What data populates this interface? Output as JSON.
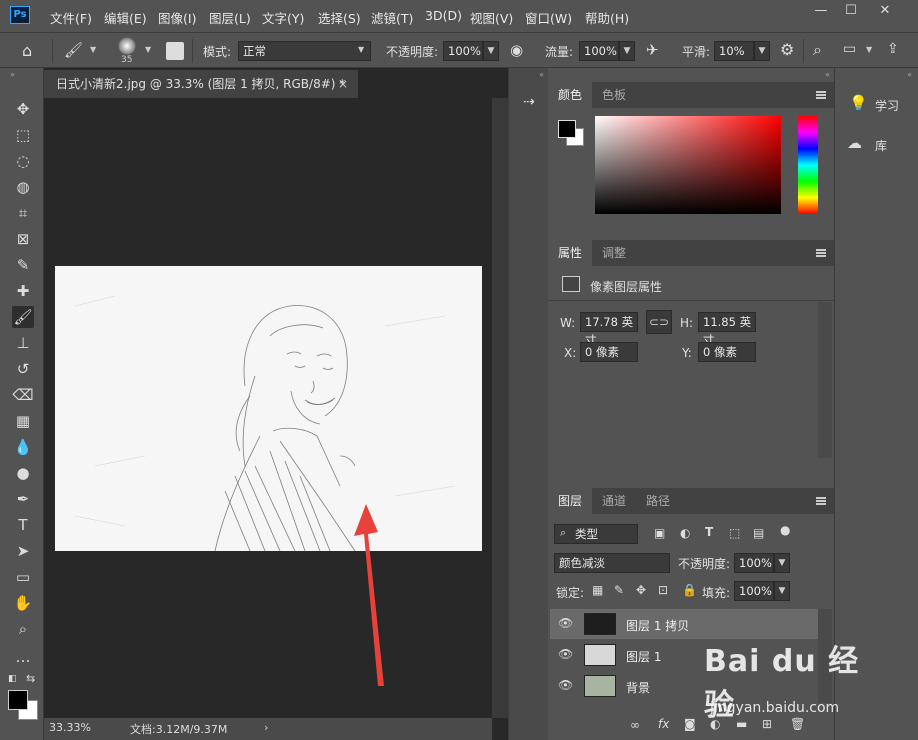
{
  "app": {
    "logo": "Ps"
  },
  "menu": [
    "文件(F)",
    "编辑(E)",
    "图像(I)",
    "图层(L)",
    "文字(Y)",
    "选择(S)",
    "滤镜(T)",
    "3D(D)",
    "视图(V)",
    "窗口(W)",
    "帮助(H)"
  ],
  "window_controls": {
    "minimize": "—",
    "maximize": "☐",
    "close": "✕"
  },
  "options": {
    "brush_size": "35",
    "mode_label": "模式:",
    "mode_value": "正常",
    "opacity_label": "不透明度:",
    "opacity_value": "100%",
    "flow_label": "流量:",
    "flow_value": "100%",
    "smooth_label": "平滑:",
    "smooth_value": "10%"
  },
  "document": {
    "tab_title": "日式小清新2.jpg @ 33.3% (图层 1 拷贝, RGB/8#) *",
    "close": "×",
    "zoom": "33.33%",
    "doc_info": "文档:3.12M/9.37M"
  },
  "color_panel": {
    "tabs": [
      "颜色",
      "色板"
    ],
    "foreground": "#000000",
    "background": "#ffffff",
    "hue": "#ff0000"
  },
  "properties_panel": {
    "tabs": [
      "属性",
      "调整"
    ],
    "title": "像素图层属性",
    "w_label": "W:",
    "w_value": "17.78 英寸",
    "h_label": "H:",
    "h_value": "11.85 英寸",
    "x_label": "X:",
    "x_value": "0 像素",
    "y_label": "Y:",
    "y_value": "0 像素"
  },
  "layers_panel": {
    "tabs": [
      "图层",
      "通道",
      "路径"
    ],
    "filter_label": "类型",
    "blend_mode": "颜色减淡",
    "opacity_label": "不透明度:",
    "opacity_value": "100%",
    "lock_label": "锁定:",
    "fill_label": "填充:",
    "fill_value": "100%",
    "layers": [
      {
        "name": "图层 1 拷贝",
        "selected": true
      },
      {
        "name": "图层 1",
        "selected": false
      },
      {
        "name": "背景",
        "selected": false
      }
    ]
  },
  "right_panel": {
    "learn": "学习",
    "library": "库"
  },
  "watermark": {
    "text": "Bai du 经验",
    "sub": "jingyan.baidu.com"
  },
  "colors": {
    "arrow": "#e8403a",
    "accent": "#31a8ff"
  }
}
